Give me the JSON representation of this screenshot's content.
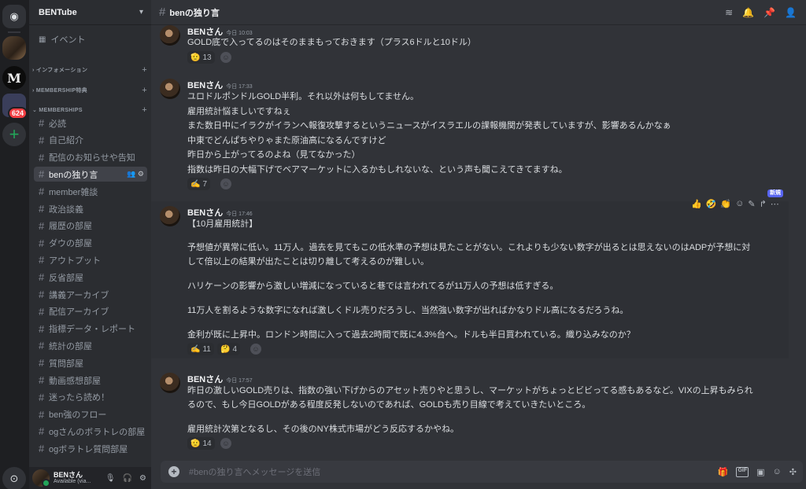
{
  "servers": {
    "badge": "624"
  },
  "guild": {
    "name": "BENTube"
  },
  "events_label": "イベント",
  "categories": [
    {
      "label": "インフォメーション"
    },
    {
      "label": "MEMBERSHIP特典"
    },
    {
      "label": "MEMBERSHIPS"
    }
  ],
  "channels": [
    "必読",
    "自己紹介",
    "配信のお知らせや告知",
    "benの独り言",
    "member雑談",
    "政治談義",
    "履歴の部屋",
    "ダウの部屋",
    "アウトプット",
    "反省部屋",
    "講義アーカイブ",
    "配信アーカイブ",
    "指標データ・レポート",
    "統計の部屋",
    "質問部屋",
    "動画感想部屋",
    "迷ったら読め！",
    "ben強のフロー",
    "ogさんのボラトレの部屋",
    "ogボラトレ質問部屋"
  ],
  "user": {
    "name": "BENさん",
    "status": "Available (via..."
  },
  "channel_title": "benの独り言",
  "messages": [
    {
      "author": "BENさん",
      "time": "今日 10:03",
      "lines": [
        "GOLD底で入ってるのはそのままもっておきます（プラス6ドルと10ドル）"
      ],
      "reactions": [
        {
          "emoji": "🫡",
          "count": "13"
        }
      ]
    },
    {
      "author": "BENさん",
      "time": "今日 17:33",
      "lines": [
        "ユロドルポンドルGOLD半利。それ以外は何もしてません。",
        "雇用統計悩ましいですねぇ",
        "また数日中にイラクがイランへ報復攻撃するというニュースがイスラエルの課報機関が発表していますが、影響あるんかなぁ",
        "中東でどんぱちやりゃまた原油高になるんですけど",
        "昨日から上がってるのよね（見てなかった）",
        "指数は昨日の大幅下げでベアマーケットに入るかもしれないな、という声も聞こえてきてますね。"
      ],
      "reactions": [
        {
          "emoji": "✍️",
          "count": "7"
        }
      ]
    },
    {
      "author": "BENさん",
      "time": "今日 17:46",
      "lines": [
        "【10月雇用統計】",
        "予想値が異常に低い。11万人。過去を見てもこの低水準の予想は見たことがない。これよりも少ない数字が出るとは思えないのはADPが予想に対",
        "して倍以上の結果が出たことは切り離して考えるのが難しい。",
        "ハリケーンの影響から激しい増減になっていると巷では言われてるが11万人の予想は低すぎる。",
        "11万人を割るような数字になれば激しくドル売りだろうし、当然強い数字が出ればかなりドル高になるだろうね。",
        "金利が既に上昇中。ロンドン時間に入って過去2時間で既に4.3%台へ。ドルも半日買われている。織り込みなのか？"
      ],
      "reactions": [
        {
          "emoji": "✍️",
          "count": "11"
        },
        {
          "emoji": "🤔",
          "count": "4"
        }
      ]
    },
    {
      "author": "BENさん",
      "time": "今日 17:57",
      "lines": [
        "昨日の激しいGOLD売りは、指数の強い下げからのアセット売りやと思うし、マーケットがちょっとビビってる感もあるなど。VIXの上昇もみられ",
        "るので、もし今日GOLDがある程度反発しないのであれば、GOLDも売り目線で考えていきたいところ。",
        "雇用統計次第となるし、その後のNY株式市場がどう反応するかやね。"
      ],
      "reactions": [
        {
          "emoji": "🫡",
          "count": "14"
        }
      ]
    }
  ],
  "hover_toolbar": {
    "new_label": "新規"
  },
  "composer": {
    "placeholder": "#benの独り言へメッセージを送信"
  }
}
